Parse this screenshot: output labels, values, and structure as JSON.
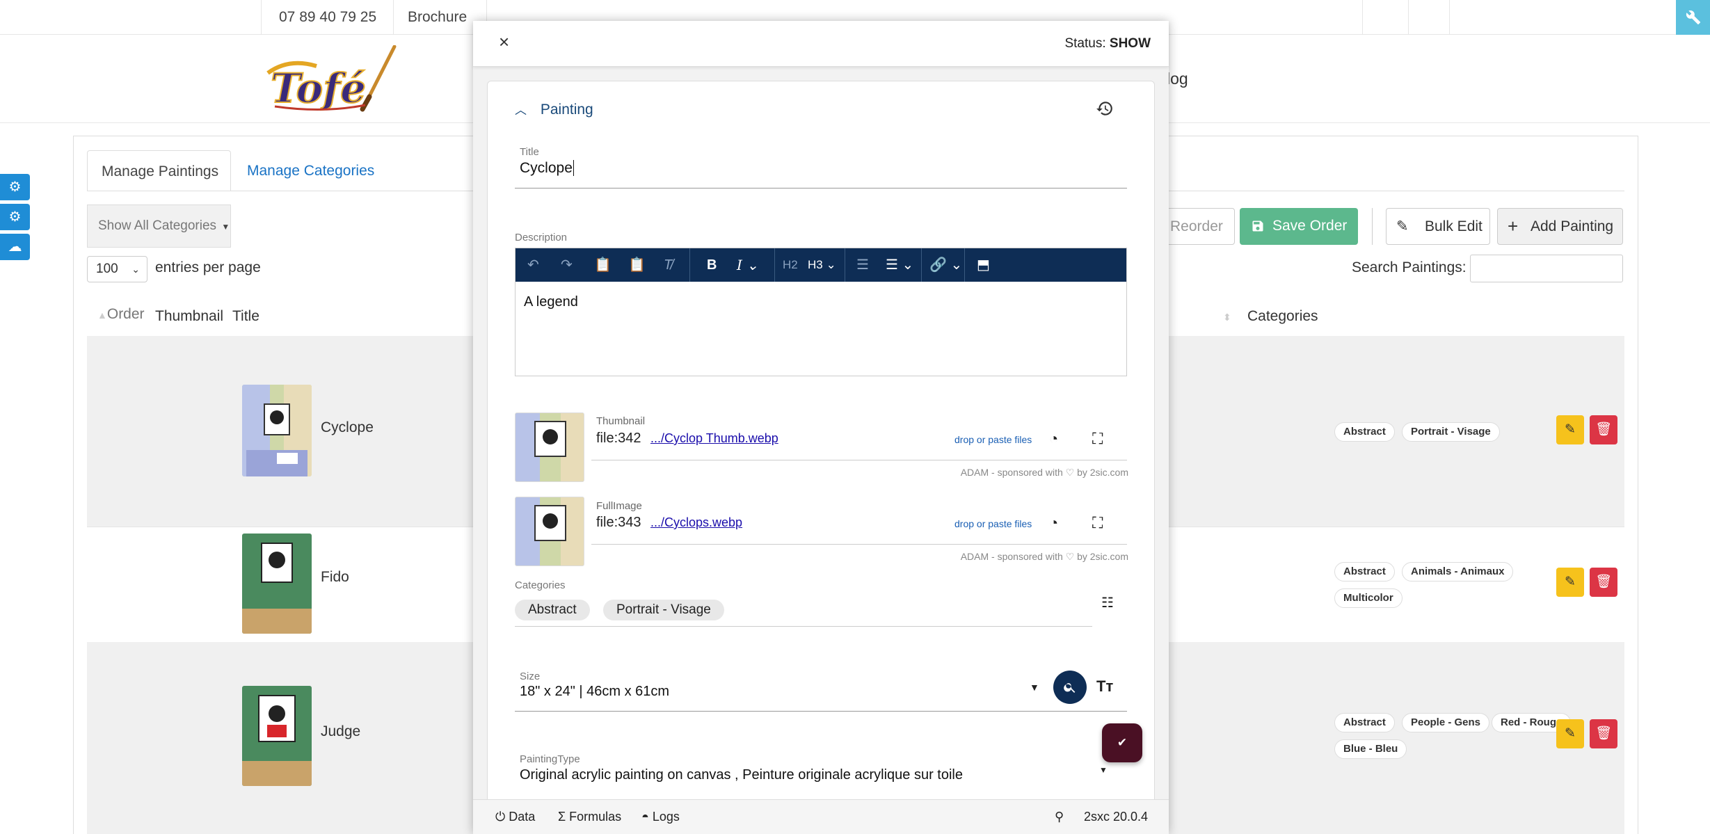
{
  "topbar": {
    "phone": "07 89 40 79 25",
    "brochure": "Brochure",
    "wrench_icon": "wrench-icon"
  },
  "header": {
    "logo_text": "Tofé",
    "nav_partial": "log"
  },
  "sidetools": {
    "icons": [
      "cogs-icon",
      "gear-icon",
      "cloud-upload-icon"
    ]
  },
  "tabs": [
    {
      "label": "Manage Paintings",
      "active": true
    },
    {
      "label": "Manage Categories",
      "active": false
    }
  ],
  "toolbar": {
    "category_filter": "Show All Categories",
    "entries_value": "100",
    "entries_label": "entries per page",
    "reorder_label": "Reorder",
    "save_order_label": "Save Order",
    "bulk_edit_label": "Bulk Edit",
    "add_painting_label": "Add Painting",
    "search_label": "Search Paintings:",
    "search_value": ""
  },
  "table": {
    "headers": {
      "order": "Order",
      "thumbnail": "Thumbnail",
      "title": "Title",
      "categories": "Categories"
    },
    "rows": [
      {
        "title": "Cyclope",
        "categories": [
          "Abstract",
          "Portrait - Visage"
        ]
      },
      {
        "title": "Fido",
        "categories": [
          "Abstract",
          "Animals - Animaux",
          "Multicolor"
        ]
      },
      {
        "title": "Judge",
        "categories": [
          "Abstract",
          "People - Gens",
          "Red - Rouge",
          "Blue - Bleu"
        ]
      }
    ]
  },
  "dialog": {
    "status_label": "Status:",
    "status_value": "SHOW",
    "group_title": "Painting",
    "fields": {
      "title_label": "Title",
      "title_value": "Cyclope",
      "description_label": "Description",
      "description_value": "A legend",
      "toolbar_h2": "H2",
      "toolbar_h3": "H3",
      "thumbnail": {
        "label": "Thumbnail",
        "file": "file:342",
        "link": ".../Cyclop Thumb.webp",
        "drop": "drop or paste files",
        "sponsor": "ADAM - sponsored with ♡ by 2sic.com"
      },
      "fullimage": {
        "label": "FullImage",
        "file": "file:343",
        "link": ".../Cyclops.webp",
        "drop": "drop or paste files",
        "sponsor": "ADAM - sponsored with ♡ by 2sic.com"
      },
      "categories_label": "Categories",
      "categories": [
        "Abstract",
        "Portrait - Visage"
      ],
      "size_label": "Size",
      "size_value": "18\" x 24\" | 46cm x 61cm",
      "painting_type_label": "PaintingType",
      "painting_type_value": "Original acrylic painting on canvas , Peinture originale acrylique sur toile"
    },
    "footer": {
      "data": "Data",
      "formulas": "Formulas",
      "logs": "Logs",
      "version": "2sxc 20.0.4"
    }
  },
  "colors": {
    "accent_blue": "#1a73c5",
    "save_green": "#5cb88d",
    "editor_navy": "#0e2d55",
    "edit_yellow": "#f6c21c",
    "delete_red": "#dc3545",
    "fab_maroon": "#4a1024",
    "side_blue": "#1f8dd6",
    "wrench_cyan": "#5bc0de"
  }
}
